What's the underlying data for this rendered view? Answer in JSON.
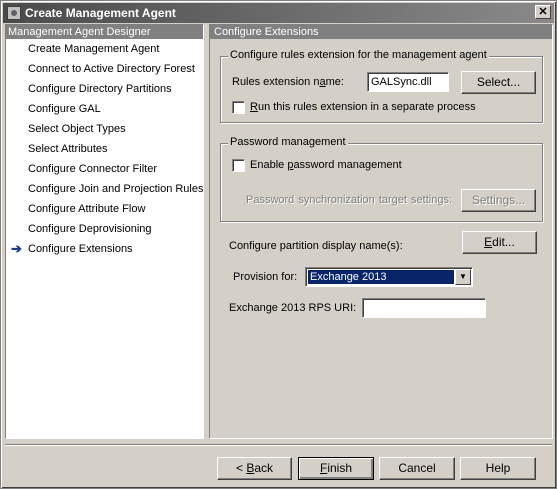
{
  "window": {
    "title": "Create Management Agent",
    "close_symbol": "✕"
  },
  "left_pane": {
    "header": "Management Agent Designer",
    "items": [
      "Create Management Agent",
      "Connect to Active Directory Forest",
      "Configure Directory Partitions",
      "Configure GAL",
      "Select Object Types",
      "Select Attributes",
      "Configure Connector Filter",
      "Configure Join and Projection Rules",
      "Configure Attribute Flow",
      "Configure Deprovisioning",
      "Configure Extensions"
    ],
    "current_index": 10,
    "current_marker": "➔"
  },
  "right_pane": {
    "header": "Configure Extensions",
    "rules_group": {
      "title": "Configure rules extension for the management agent",
      "name_label_pre": "Rules extension n",
      "name_label_accel": "a",
      "name_label_post": "me:",
      "name_value": "GALSync.dll",
      "select_button": "Select...",
      "separate_process_pre": "",
      "separate_process_accel": "R",
      "separate_process_post": "un this rules extension in a separate process"
    },
    "password_group": {
      "title": "Password management",
      "enable_pre": "Enable ",
      "enable_accel": "p",
      "enable_post": "assword management",
      "target_label": "Password synchronization  target settings:",
      "settings_button": "Settings..."
    },
    "partition_label": "Configure partition display name(s):",
    "edit_button_accel": "E",
    "edit_button_post": "dit...",
    "provision_label": "Provision for:",
    "provision_value": "Exchange 2013",
    "rps_label": "Exchange 2013 RPS URI:",
    "rps_value": ""
  },
  "footer": {
    "back_prefix": "< ",
    "back_accel": "B",
    "back_post": "ack",
    "finish_accel": "F",
    "finish_post": "inish",
    "cancel": "Cancel",
    "help": "Help"
  },
  "colors": {
    "face": "#d4d0c8",
    "pane_header": "#808080",
    "selection": "#0a246a"
  },
  "icons": {
    "window": "management-agent-icon",
    "current_step": "arrow-right-icon",
    "dropdown": "triangle-down-icon"
  }
}
